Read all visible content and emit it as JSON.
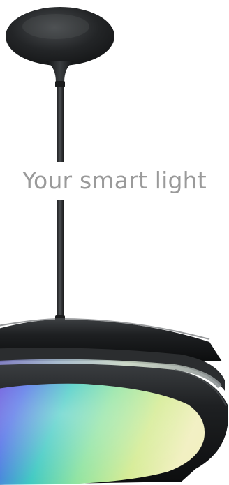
{
  "hero": {
    "headline": "Your smart light"
  },
  "colors": {
    "background": "#ffffff",
    "headline": "#9a9a9a",
    "fixture": "#1d1f21",
    "cord": "#2a2c2e"
  },
  "icons": {
    "product_image": "pendant-lamp-illustration"
  }
}
